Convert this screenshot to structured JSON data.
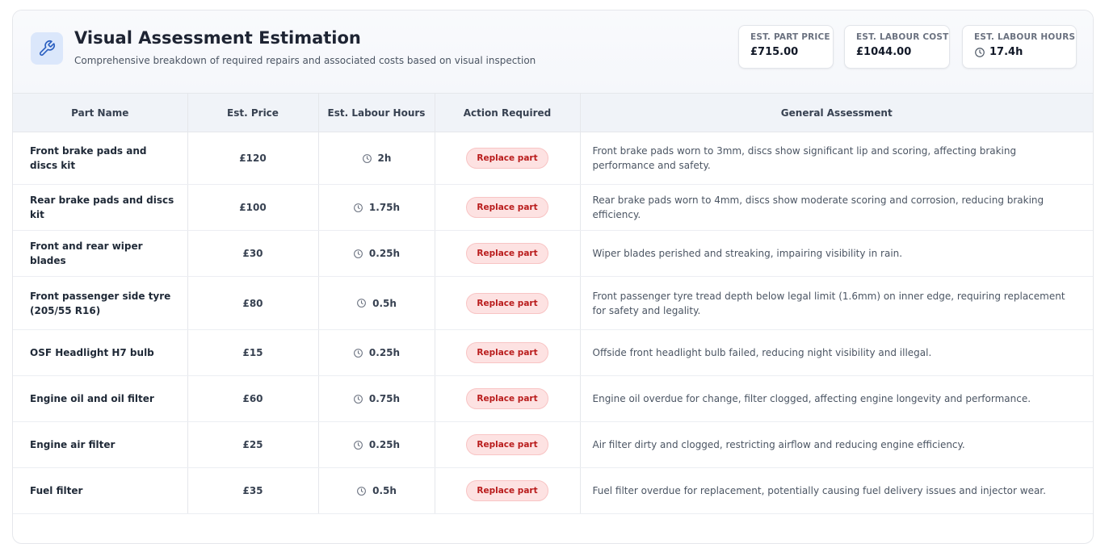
{
  "header": {
    "title": "Visual Assessment Estimation",
    "subtitle": "Comprehensive breakdown of required repairs and associated costs based on visual inspection",
    "icon": "wrench-icon",
    "accent_color": "#2b5fc0"
  },
  "stats": {
    "part_price": {
      "label": "EST. PART PRICE",
      "value": "£715.00"
    },
    "labour_cost": {
      "label": "EST. LABOUR COST",
      "value": "£1044.00"
    },
    "labour_hours": {
      "label": "EST. LABOUR HOURS",
      "value": "17.4h",
      "icon": "clock-icon"
    }
  },
  "table": {
    "columns": [
      "Part Name",
      "Est. Price",
      "Est. Labour Hours",
      "Action Required",
      "General Assessment"
    ],
    "rows": [
      {
        "part": "Front brake pads and discs kit",
        "price": "£120",
        "hours": "2h",
        "action": "Replace part",
        "assessment": "Front brake pads worn to 3mm, discs show significant lip and scoring, affecting braking performance and safety."
      },
      {
        "part": "Rear brake pads and discs kit",
        "price": "£100",
        "hours": "1.75h",
        "action": "Replace part",
        "assessment": "Rear brake pads worn to 4mm, discs show moderate scoring and corrosion, reducing braking efficiency."
      },
      {
        "part": "Front and rear wiper blades",
        "price": "£30",
        "hours": "0.25h",
        "action": "Replace part",
        "assessment": "Wiper blades perished and streaking, impairing visibility in rain."
      },
      {
        "part": "Front passenger side tyre (205/55 R16)",
        "price": "£80",
        "hours": "0.5h",
        "action": "Replace part",
        "assessment": "Front passenger tyre tread depth below legal limit (1.6mm) on inner edge, requiring replacement for safety and legality."
      },
      {
        "part": "OSF Headlight H7 bulb",
        "price": "£15",
        "hours": "0.25h",
        "action": "Replace part",
        "assessment": "Offside front headlight bulb failed, reducing night visibility and illegal."
      },
      {
        "part": "Engine oil and oil filter",
        "price": "£60",
        "hours": "0.75h",
        "action": "Replace part",
        "assessment": "Engine oil overdue for change, filter clogged, affecting engine longevity and performance."
      },
      {
        "part": "Engine air filter",
        "price": "£25",
        "hours": "0.25h",
        "action": "Replace part",
        "assessment": "Air filter dirty and clogged, restricting airflow and reducing engine efficiency."
      },
      {
        "part": "Fuel filter",
        "price": "£35",
        "hours": "0.5h",
        "action": "Replace part",
        "assessment": "Fuel filter overdue for replacement, potentially causing fuel delivery issues and injector wear."
      }
    ]
  }
}
